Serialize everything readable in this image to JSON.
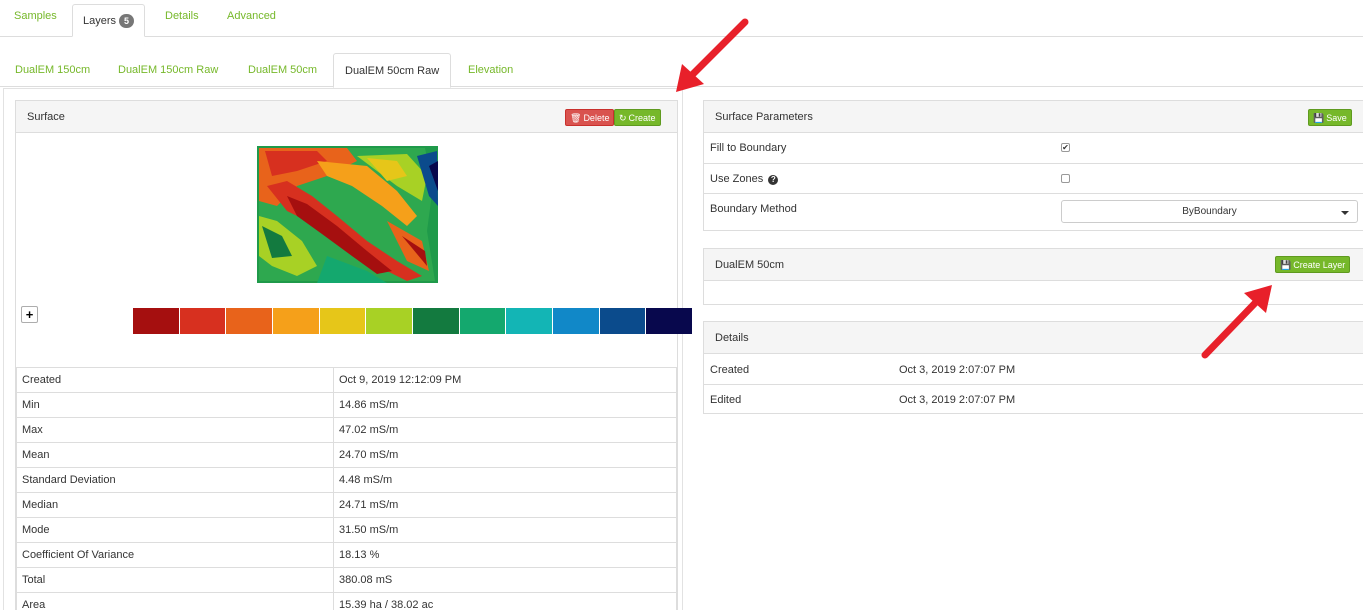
{
  "top_tabs": [
    {
      "label": "Samples",
      "active": false
    },
    {
      "label": "Layers",
      "badge": "5",
      "active": true
    },
    {
      "label": "Details",
      "active": false
    },
    {
      "label": "Advanced",
      "active": false
    }
  ],
  "layer_tabs": [
    {
      "label": "DualEM 150cm",
      "active": false
    },
    {
      "label": "DualEM 150cm Raw",
      "active": false
    },
    {
      "label": "DualEM 50cm",
      "active": false
    },
    {
      "label": "DualEM 50cm Raw",
      "active": true
    },
    {
      "label": "Elevation",
      "active": false
    }
  ],
  "surface": {
    "title": "Surface",
    "delete_label": "Delete",
    "create_label": "Create",
    "legend_colors": [
      "#a50f0f",
      "#d7301f",
      "#e8631b",
      "#f5a01a",
      "#e6c619",
      "#a8d125",
      "#137a3f",
      "#14a86e",
      "#13b5b5",
      "#1188c8",
      "#0b4b8c",
      "#08084d"
    ],
    "stats": [
      {
        "label": "Created",
        "value": "Oct 9, 2019 12:12:09 PM"
      },
      {
        "label": "Min",
        "value": "14.86 mS/m"
      },
      {
        "label": "Max",
        "value": "47.02 mS/m"
      },
      {
        "label": "Mean",
        "value": "24.70 mS/m"
      },
      {
        "label": "Standard Deviation",
        "value": "4.48 mS/m"
      },
      {
        "label": "Median",
        "value": "24.71 mS/m"
      },
      {
        "label": "Mode",
        "value": "31.50 mS/m"
      },
      {
        "label": "Coefficient Of Variance",
        "value": "18.13 %"
      },
      {
        "label": "Total",
        "value": "380.08 mS"
      },
      {
        "label": "Area",
        "value": "15.39 ha / 38.02 ac"
      }
    ]
  },
  "surface_params": {
    "title": "Surface Parameters",
    "save_label": "Save",
    "fill_to_boundary_label": "Fill to Boundary",
    "fill_to_boundary_checked": true,
    "use_zones_label": "Use Zones",
    "use_zones_checked": false,
    "boundary_method_label": "Boundary Method",
    "boundary_method_value": "ByBoundary"
  },
  "layer_panel": {
    "title": "DualEM 50cm",
    "create_layer_label": "Create Layer"
  },
  "details": {
    "title": "Details",
    "created_label": "Created",
    "created_value": "Oct 3, 2019 2:07:07 PM",
    "edited_label": "Edited",
    "edited_value": "Oct 3, 2019 2:07:07 PM"
  },
  "annotation_color": "#e8202a"
}
